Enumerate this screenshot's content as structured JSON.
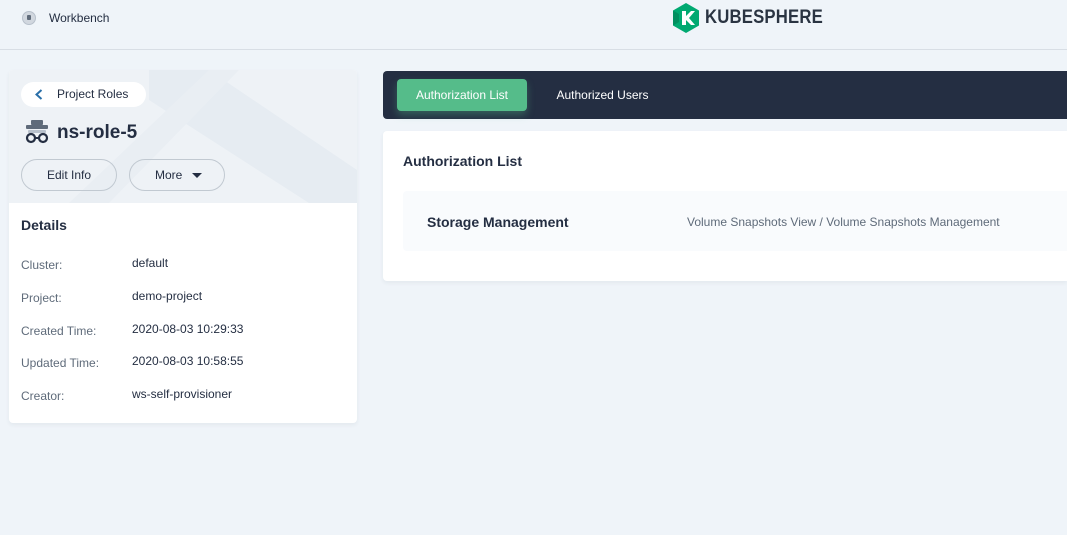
{
  "topbar": {
    "workbench_label": "Workbench",
    "brand": "KUBESPHERE",
    "brand_color": "#00a971",
    "workbench_icon": "workbench-icon"
  },
  "sidebar": {
    "back_label": "Project Roles",
    "role_name": "ns-role-5",
    "role_icon": "role-icon",
    "edit_button": "Edit Info",
    "more_button": "More",
    "details_title": "Details",
    "details": [
      {
        "key": "Cluster:",
        "value": "default"
      },
      {
        "key": "Project:",
        "value": "demo-project"
      },
      {
        "key": "Created Time:",
        "value": "2020-08-03 10:29:33"
      },
      {
        "key": "Updated Time:",
        "value": "2020-08-03 10:58:55"
      },
      {
        "key": "Creator:",
        "value": "ws-self-provisioner"
      }
    ]
  },
  "tabs": [
    {
      "label": "Authorization List",
      "active": true
    },
    {
      "label": "Authorized Users",
      "active": false
    }
  ],
  "main": {
    "list_title": "Authorization List",
    "rows": [
      {
        "name": "Storage Management",
        "permissions": "Volume Snapshots View / Volume Snapshots Management"
      }
    ]
  },
  "colors": {
    "accent": "#55bc8a",
    "tabbar_bg": "#242e42",
    "page_bg": "#eff4f9"
  }
}
